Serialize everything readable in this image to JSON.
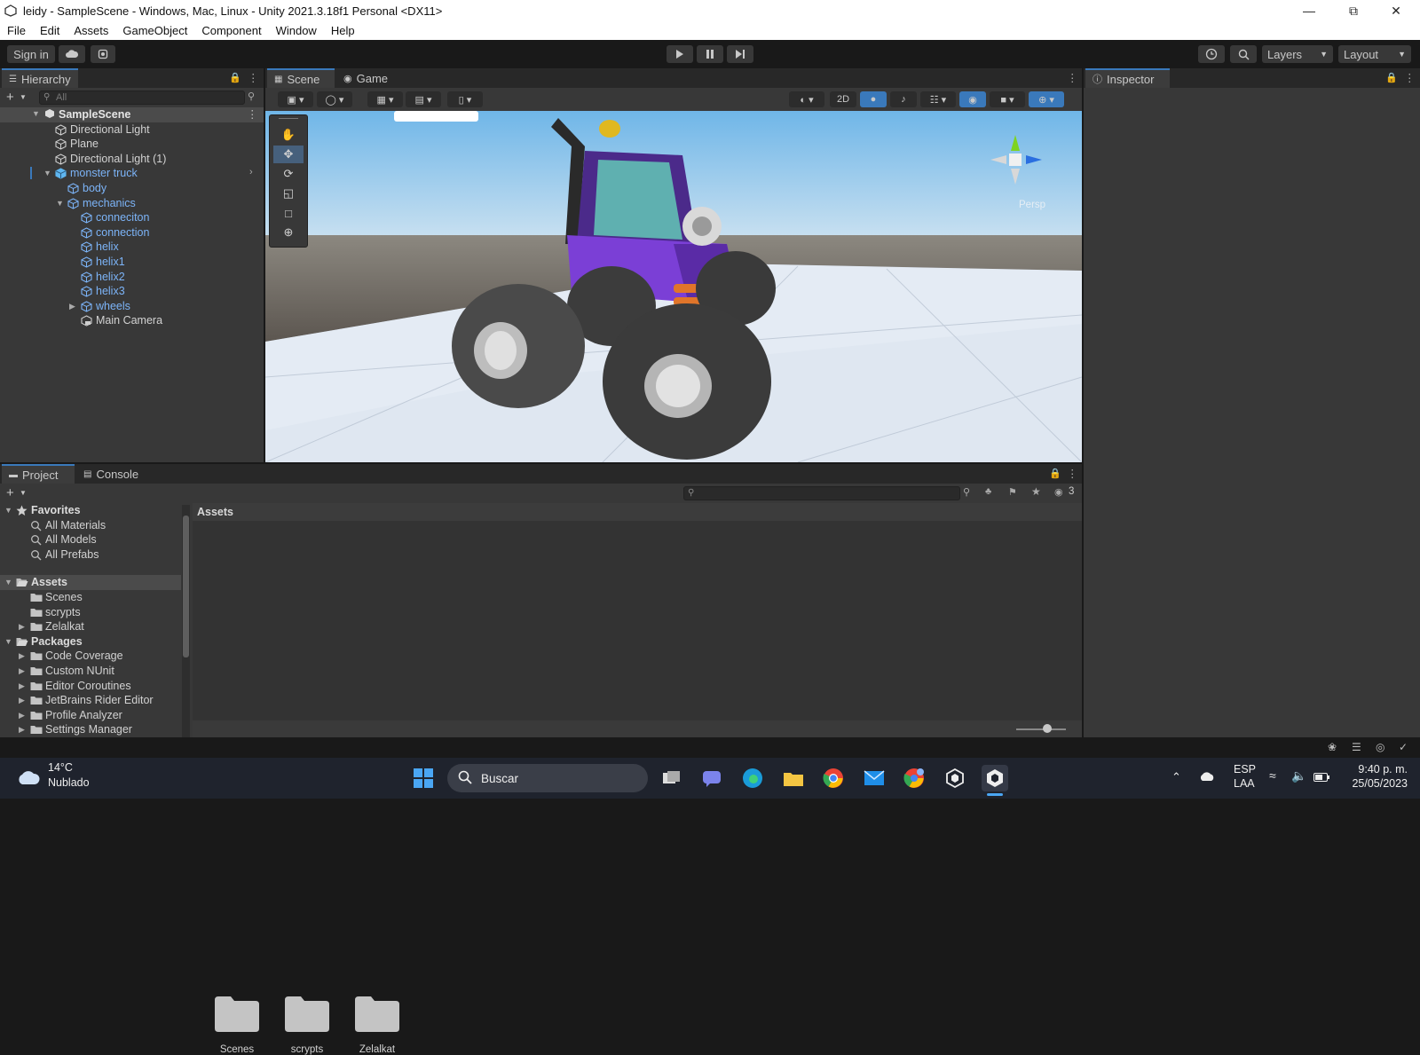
{
  "window": {
    "title": "leidy - SampleScene - Windows, Mac, Linux - Unity 2021.3.18f1 Personal <DX11>",
    "controls": [
      "minimize-icon",
      "restore-icon",
      "close-icon"
    ]
  },
  "menu": [
    "File",
    "Edit",
    "Assets",
    "GameObject",
    "Component",
    "Window",
    "Help"
  ],
  "toolbar": {
    "sign_in": "Sign in",
    "layers": "Layers",
    "layout": "Layout"
  },
  "hierarchy": {
    "tab": "Hierarchy",
    "search_placeholder": "All",
    "scene": "SampleScene",
    "items": [
      {
        "label": "Directional Light",
        "blue": false
      },
      {
        "label": "Plane",
        "blue": false
      },
      {
        "label": "Directional Light (1)",
        "blue": false
      },
      {
        "label": "monster truck",
        "blue": true
      },
      {
        "label": "body",
        "blue": true
      },
      {
        "label": "mechanics",
        "blue": true
      },
      {
        "label": "conneciton",
        "blue": true
      },
      {
        "label": "connection",
        "blue": true
      },
      {
        "label": "helix",
        "blue": true
      },
      {
        "label": "helix1",
        "blue": true
      },
      {
        "label": "helix2",
        "blue": true
      },
      {
        "label": "helix3",
        "blue": true
      },
      {
        "label": "wheels",
        "blue": true
      },
      {
        "label": "Main Camera",
        "blue": false
      }
    ]
  },
  "scene_view": {
    "tabs": [
      "Scene",
      "Game"
    ],
    "mode_2d": "2D",
    "persp": "Persp"
  },
  "inspector": {
    "tab": "Inspector"
  },
  "project": {
    "tabs": [
      "Project",
      "Console"
    ],
    "hidden_count": "3",
    "favorites": {
      "label": "Favorites",
      "items": [
        "All Materials",
        "All Models",
        "All Prefabs"
      ]
    },
    "assets": {
      "label": "Assets",
      "items": [
        "Scenes",
        "scrypts",
        "Zelalkat"
      ]
    },
    "packages": {
      "label": "Packages",
      "items": [
        "Code Coverage",
        "Custom NUnit",
        "Editor Coroutines",
        "JetBrains Rider Editor",
        "Profile Analyzer",
        "Settings Manager"
      ]
    },
    "breadcrumb": "Assets",
    "grid": [
      "Scenes",
      "scrypts",
      "Zelalkat"
    ]
  },
  "taskbar": {
    "weather_temp": "14°C",
    "weather_desc": "Nublado",
    "search": "Buscar",
    "lang1": "ESP",
    "lang2": "LAA",
    "time": "9:40 p. m.",
    "date": "25/05/2023"
  },
  "colors": {
    "accent": "#3a79bb",
    "truck": "#7b3fd6",
    "ground": "#dde6f0",
    "sky": "#87c2ea"
  }
}
